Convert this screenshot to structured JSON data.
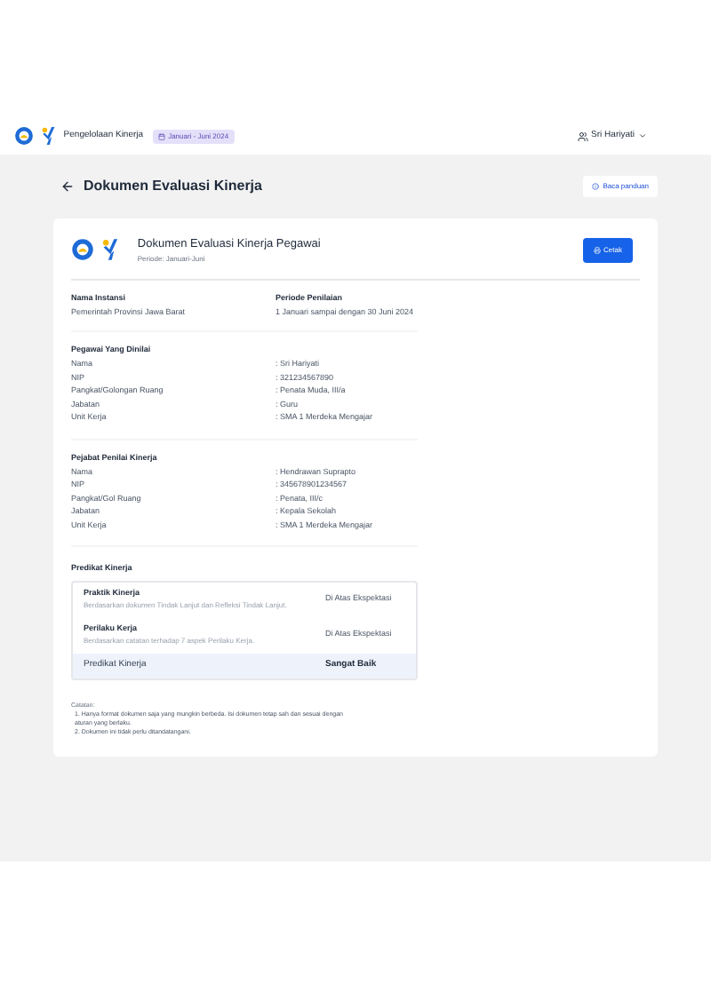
{
  "header": {
    "app_title": "Pengelolaan Kinerja",
    "period_badge": "Januari - Juni 2024",
    "user": "Sri Hariyati"
  },
  "page": {
    "title": "Dokumen Evaluasi Kinerja",
    "guide_button": "Baca panduan"
  },
  "document": {
    "title": "Dokumen Evaluasi Kinerja Pegawai",
    "subtitle": "Periode: Januari-Juni",
    "print_button": "Cetak",
    "info": [
      {
        "label": "Nama Instansi",
        "value": "Pemerintah Provinsi Jawa Barat"
      },
      {
        "label": "Periode Penilaian",
        "value": "1 Januari sampai dengan 30 Juni 2024"
      }
    ],
    "sections": [
      {
        "title": "Pegawai Yang Dinilai",
        "rows": [
          {
            "label": "Nama",
            "value": ": Sri Hariyati"
          },
          {
            "label": "NIP",
            "value": ": 321234567890"
          },
          {
            "label": "Pangkat/Golongan Ruang",
            "value": ": Penata Muda, III/a"
          },
          {
            "label": "Jabatan",
            "value": ": Guru"
          },
          {
            "label": "Unit Kerja",
            "value": ": SMA 1 Merdeka Mengajar"
          }
        ]
      },
      {
        "title": "Pejabat Penilai Kinerja",
        "rows": [
          {
            "label": "Nama",
            "value": ": Hendrawan Suprapto"
          },
          {
            "label": "NIP",
            "value": ": 345678901234567"
          },
          {
            "label": "Pangkat/Gol Ruang",
            "value": ": Penata, III/c"
          },
          {
            "label": "Jabatan",
            "value": ": Kepala Sekolah"
          },
          {
            "label": "Unit Kerja",
            "value": ": SMA 1 Merdeka Mengajar"
          }
        ]
      }
    ],
    "predikat": {
      "title": "Predikat Kinerja",
      "items": [
        {
          "name": "Praktik Kinerja",
          "description": "Berdasarkan dokumen Tindak Lanjut dan Refleksi Tindak Lanjut.",
          "result": "Di Atas Ekspektasi"
        },
        {
          "name": "Perilaku Kerja",
          "description": "Berdasarkan catatan terhadap 7 aspek Perilaku Kerja.",
          "result": "Di Atas Ekspektasi"
        }
      ],
      "total": {
        "name": "Predikat Kinerja",
        "result": "Sangat Baik"
      }
    },
    "notes": {
      "title": "Catatan:",
      "items": [
        "1. Hanya format dokumen saja yang mungkin berbeda. Isi dokumen tetap sah dan sesuai dengan aturan yang berlaku.",
        "2. Dokumen ini tidak perlu ditandatangani."
      ]
    }
  }
}
